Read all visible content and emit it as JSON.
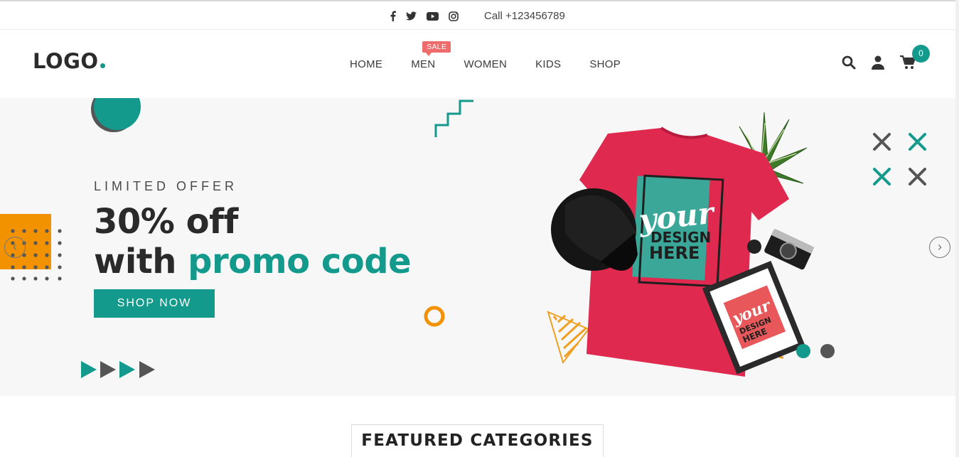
{
  "topbar": {
    "social_icons": [
      "facebook-icon",
      "twitter-icon",
      "youtube-icon",
      "instagram-icon"
    ],
    "call_text": "Call +123456789"
  },
  "header": {
    "logo_text": "LOGO",
    "nav": [
      {
        "label": "HOME"
      },
      {
        "label": "MEN",
        "badge": "SALE"
      },
      {
        "label": "WOMEN"
      },
      {
        "label": "KIDS"
      },
      {
        "label": "SHOP"
      }
    ],
    "icons": [
      "search-icon",
      "user-icon",
      "cart-icon"
    ],
    "cart_count": "0"
  },
  "hero": {
    "subtitle": "LIMITED OFFER",
    "headline_line1": "30% off",
    "headline_line2_prefix": "with ",
    "headline_line2_accent": "promo code",
    "button_label": "SHOP NOW",
    "tshirt_text": [
      "your",
      "DESIGN",
      "HERE"
    ],
    "frame_text": [
      "your",
      "DESIGN",
      "HERE"
    ],
    "slider_dots": 2,
    "active_dot": 0
  },
  "featured": {
    "title": "FEATURED CATEGORIES"
  },
  "colors": {
    "accent": "#139a8c",
    "sale": "#ef6c6c",
    "orange": "#f0a020",
    "tshirt": "#e0294e"
  }
}
